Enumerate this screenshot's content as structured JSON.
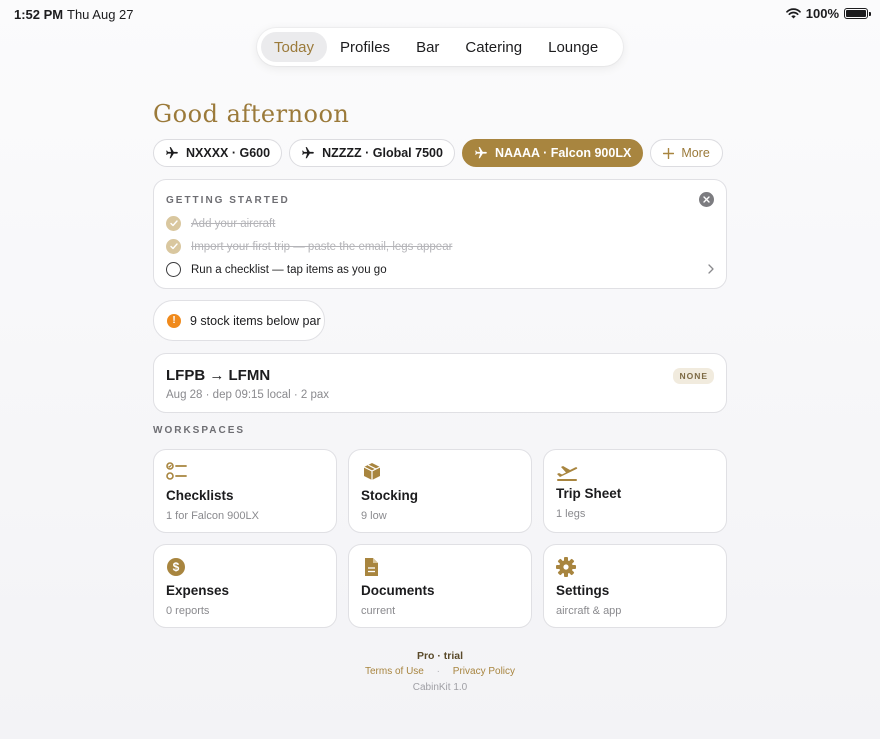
{
  "status": {
    "time": "1:52 PM",
    "date": "Thu Aug 27",
    "battery": "100%"
  },
  "nav": {
    "tabs": [
      "Today",
      "Profiles",
      "Bar",
      "Catering",
      "Lounge"
    ],
    "active": "Today"
  },
  "greeting": "Good afternoon",
  "aircraft": [
    {
      "label": "NXXXX · G600",
      "active": false
    },
    {
      "label": "NZZZZ · Global 7500",
      "active": false
    },
    {
      "label": "NAAAA · Falcon 900LX",
      "active": true
    }
  ],
  "more_label": "More",
  "getting_started": {
    "title": "GETTING STARTED",
    "items": [
      {
        "text": "Add your aircraft",
        "done": true
      },
      {
        "text": "Import your first trip — paste the email, legs appear",
        "done": true
      },
      {
        "text": "Run a checklist — tap items as you go",
        "done": false
      }
    ]
  },
  "stock_alert": {
    "icon": "!",
    "text": "9 stock items below par"
  },
  "trip": {
    "route": "LFPB → LFMN",
    "details": "Aug 28 · dep 09:15 local · 2 pax",
    "badge": "NONE"
  },
  "workspaces_label": "WORKSPACES",
  "tiles": [
    {
      "title": "Checklists",
      "subtitle": "1 for Falcon 900LX",
      "icon": "checklist-icon"
    },
    {
      "title": "Stocking",
      "subtitle": "9 low",
      "icon": "box-icon"
    },
    {
      "title": "Trip Sheet",
      "subtitle": "1 legs",
      "icon": "plane-takeoff-icon"
    },
    {
      "title": "Expenses",
      "subtitle": "0 reports",
      "icon": "dollar-icon"
    },
    {
      "title": "Documents",
      "subtitle": "current",
      "icon": "document-icon"
    },
    {
      "title": "Settings",
      "subtitle": "aircraft & app",
      "icon": "gear-icon"
    }
  ],
  "footer": {
    "plan": "Pro · trial",
    "terms": "Terms of Use",
    "sep": "·",
    "privacy": "Privacy Policy",
    "version": "CabinKit 1.0"
  },
  "colors": {
    "accent": "#a8853f",
    "warning": "#f08a1c"
  }
}
